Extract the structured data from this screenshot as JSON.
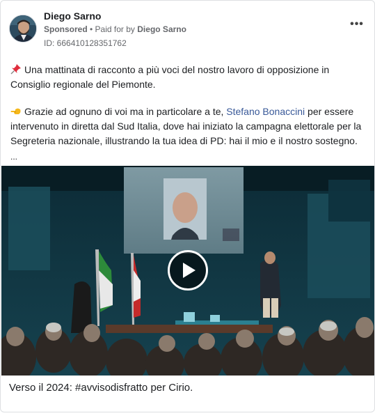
{
  "post": {
    "author": "Diego Sarno",
    "sponsored": "Sponsored",
    "separator": " • ",
    "paid_for_prefix": "Paid for by",
    "paid_for_name": "Diego Sarno",
    "ad_id": "ID: 666410128351762",
    "more_label": "•••"
  },
  "body": {
    "para1_emoji": "pushpin-icon",
    "para1": "Una mattinata di racconto a più voci del nostro lavoro di opposizione in Consiglio regionale del Piemonte.",
    "para2_emoji": "pointing-hand-icon",
    "para2_before": "Grazie ad ognuno di voi ma in particolare a te, ",
    "para2_link": "Stefano Bonaccini",
    "para2_after": " per essere intervenuto in diretta dal Sud Italia, dove hai iniziato la campagna elettorale per la Segreteria nazionale, illustrando la tua idea di PD: hai il mio e il nostro sostegno.",
    "ellipsis": "..."
  },
  "media": {
    "type": "video",
    "play_icon": "play-icon"
  },
  "caption": "Verso il 2024: #avvisodisfratto per Cirio."
}
